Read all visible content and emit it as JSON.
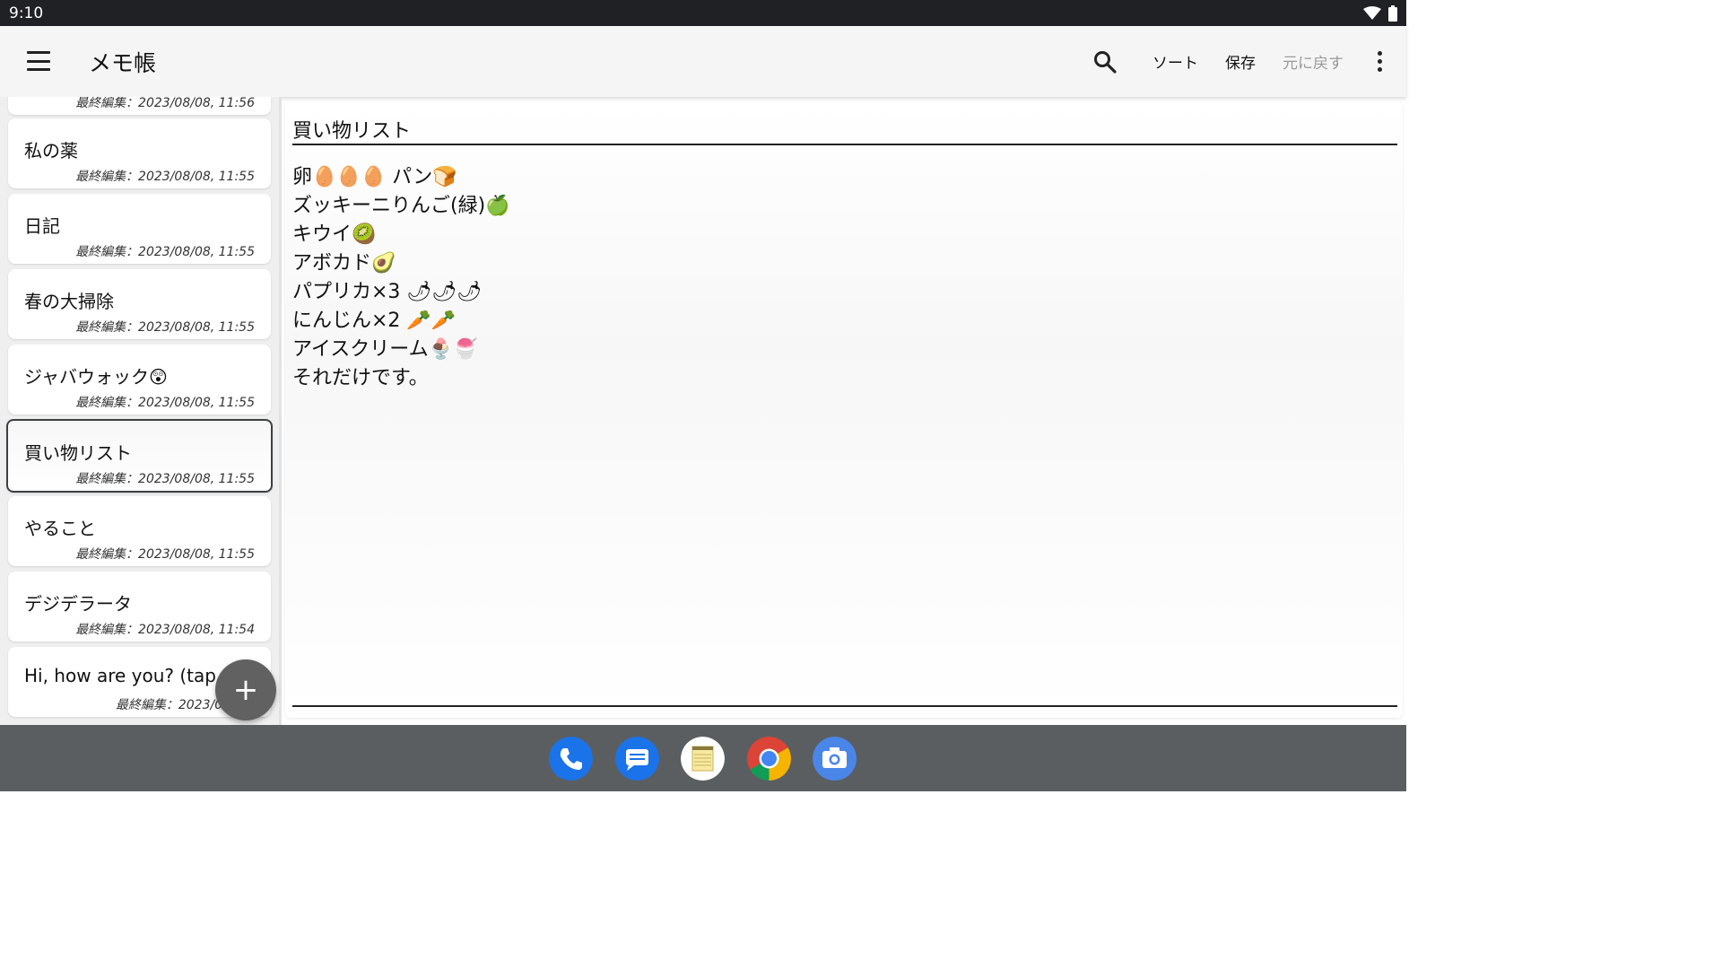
{
  "status_bar": {
    "time": "9:10"
  },
  "app_bar": {
    "title": "メモ帳",
    "sort_label": "ソート",
    "save_label": "保存",
    "undo_label": "元に戻す"
  },
  "notes": [
    {
      "title": "",
      "date": "最終編集：2023/08/08, 11:56"
    },
    {
      "title": "私の薬",
      "date": "最終編集：2023/08/08, 11:55"
    },
    {
      "title": "日記",
      "date": "最終編集：2023/08/08, 11:55"
    },
    {
      "title": "春の大掃除",
      "date": "最終編集：2023/08/08, 11:55"
    },
    {
      "title": "ジャバウォック😲",
      "date": "最終編集：2023/08/08, 11:55"
    },
    {
      "title": "買い物リスト",
      "date": "最終編集：2023/08/08, 11:55"
    },
    {
      "title": "やること",
      "date": "最終編集：2023/08/08, 11:55"
    },
    {
      "title": "デジデラータ",
      "date": "最終編集：2023/08/08, 11:54"
    },
    {
      "title": "Hi, how are you? (tap to o",
      "date": "最終編集：2023/08/08,"
    }
  ],
  "fab": {
    "label": "+"
  },
  "editor": {
    "title": "買い物リスト",
    "lines": [
      "卵🥚🥚🥚 パン🍞",
      "ズッキーニりんご(緑)🍏",
      "キウイ🥝",
      "アボカド🥑",
      "パプリカ×3 🌶🌶🌶",
      "にんじん×2 🥕🥕",
      "アイスクリーム🍨🍧",
      "それだけです。"
    ]
  },
  "dock": {
    "apps": [
      "phone-icon",
      "messages-icon",
      "notepad-icon",
      "chrome-icon",
      "camera-icon"
    ]
  },
  "colors": {
    "status_bar": "#202124",
    "app_bar": "#f5f5f5",
    "dock": "#5b5e61",
    "fab": "#616161"
  }
}
